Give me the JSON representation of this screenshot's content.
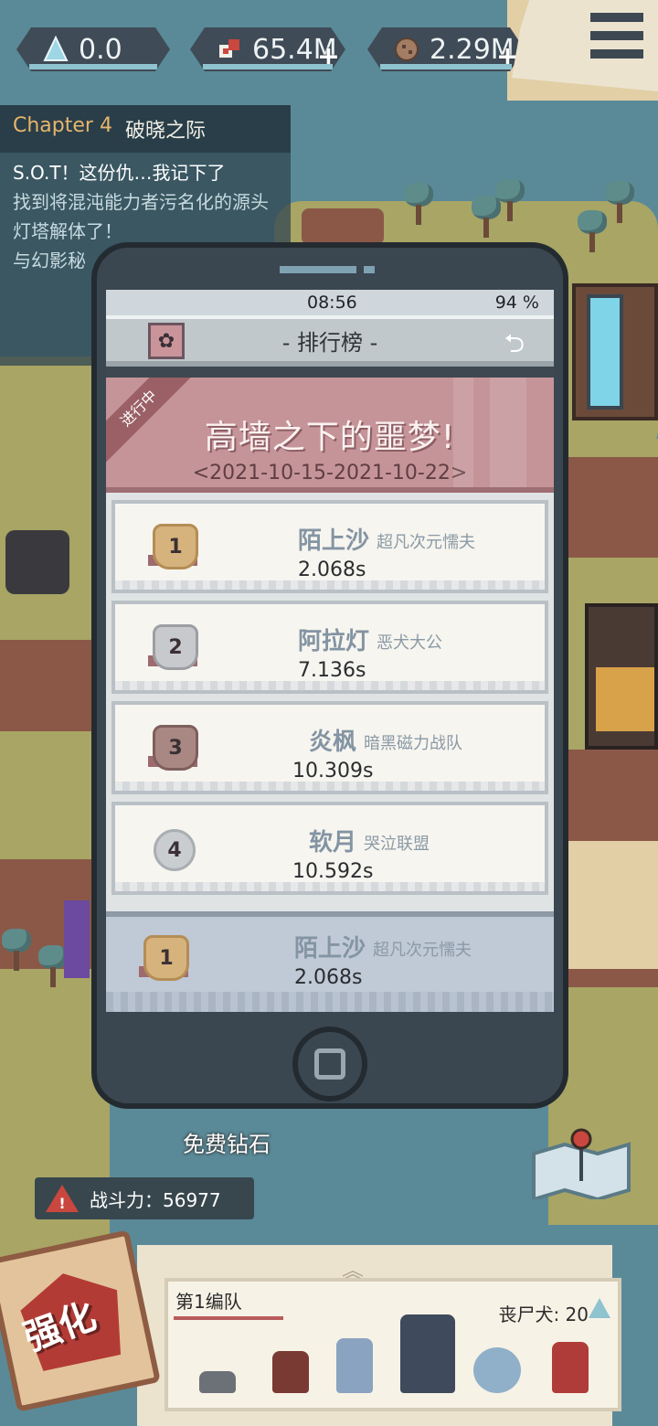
{
  "resources": [
    {
      "icon": "crystal-icon",
      "value": "0.0",
      "has_plus": false
    },
    {
      "icon": "meat-icon",
      "value": "65.4M",
      "has_plus": true
    },
    {
      "icon": "cookie-icon",
      "value": "2.29M",
      "has_plus": true
    }
  ],
  "menu": {
    "icon": "hamburger-menu-icon"
  },
  "quest": {
    "chapter_label": "Chapter 4",
    "chapter_title": "破晓之际",
    "lines": [
      "S.O.T！这份仇…我记下了",
      "找到将混沌能力者污名化的源头",
      "灯塔解体了！",
      "与幻影秘"
    ]
  },
  "phone": {
    "time": "08:56",
    "battery": "94 %",
    "title": "- 排行榜 -",
    "back_icon": "back-arrow-icon",
    "event": {
      "status": "进行中",
      "title": "高墙之下的噩梦!",
      "dates": "<2021-10-15-2021-10-22>"
    },
    "leaderboard": [
      {
        "rank": "1",
        "medal": "gold",
        "name": "陌上沙",
        "team": "超凡次元懦夫",
        "time": "2.068s"
      },
      {
        "rank": "2",
        "medal": "silver",
        "name": "阿拉灯",
        "team": "恶犬大公",
        "time": "7.136s"
      },
      {
        "rank": "3",
        "medal": "bronze",
        "name": "炎枫",
        "team": "暗黑磁力战队",
        "time": "10.309s"
      },
      {
        "rank": "4",
        "medal": "plain",
        "name": "软月",
        "team": "哭泣联盟",
        "time": "10.592s"
      }
    ],
    "self": {
      "rank": "1",
      "name": "陌上沙",
      "team": "超凡次元懦夫",
      "time": "2.068s"
    }
  },
  "hud": {
    "free_diamonds": "免费钻石",
    "power_label": "战斗力：56977",
    "upgrade_label": "强化",
    "team_name": "第1编队",
    "zombie_dogs": "丧尸犬: 20"
  },
  "colors": {
    "accent_blue": "#8fc3d0",
    "event_pink": "#c59499",
    "panel_dark": "#3a4650"
  }
}
